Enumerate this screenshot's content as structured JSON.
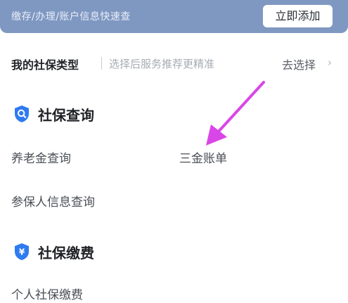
{
  "banner": {
    "text": "缴存/办理/账户信息快速查",
    "add_button": "立即添加"
  },
  "insurance_type": {
    "label": "我的社保类型",
    "hint": "选择后服务推荐更精准",
    "choose_label": "去选择",
    "chevron": "›"
  },
  "sections": [
    {
      "title": "社保查询",
      "icon": "search-shield-icon",
      "items": [
        "养老金查询",
        "三金账单",
        "参保人信息查询"
      ]
    },
    {
      "title": "社保缴费",
      "icon": "yuan-shield-icon",
      "icon_glyph": "¥",
      "items": [
        "个人社保缴费"
      ]
    }
  ],
  "colors": {
    "banner": "#7f98c2",
    "accent_blue": "#2f7bf0",
    "arrow": "#d946e8"
  }
}
